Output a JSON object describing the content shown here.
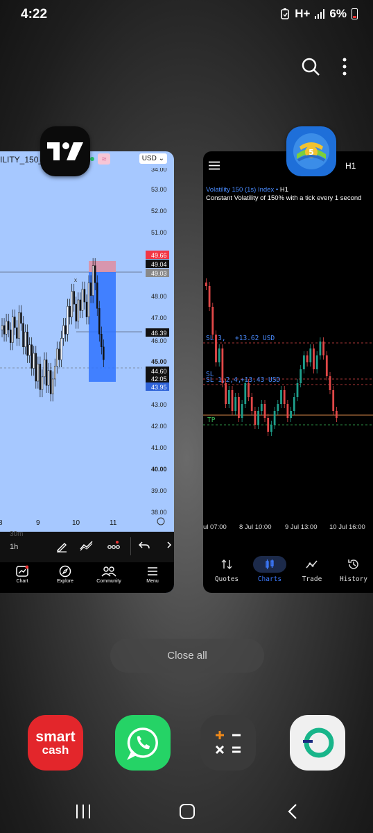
{
  "status": {
    "time": "4:22",
    "network": "H+",
    "battery": "6%"
  },
  "tradingview": {
    "symbol": "ILITY_150_",
    "currency": "USD",
    "price_labels": [
      "34.00",
      "53.00",
      "52.00",
      "51.00",
      "49.66",
      "49.04",
      "49.03",
      "48.00",
      "47.00",
      "46.39",
      "46.00",
      "45.00",
      "44.60",
      "42:05",
      "43.95",
      "43.00",
      "42.00",
      "41.00",
      "40.00",
      "39.00",
      "38.00"
    ],
    "date_labels": [
      "8",
      "9",
      "10",
      "11"
    ],
    "timeframe_faded": "30m",
    "timeframe": "1h",
    "nav": [
      "Chart",
      "Explore",
      "Community",
      "Menu"
    ]
  },
  "metatrader": {
    "timeframe": "H1",
    "info_line1_name": "Volatility 150 (1s) Index",
    "info_line1_tf": "H1",
    "info_line2": "Constant Volatility of 150% with a tick every 1 second",
    "sl_label": "SL 3,",
    "sl_profit": "+13.62 USD",
    "sl2_label": "SL",
    "sl3_label": "SL 1,2,4,",
    "sl3_profit": "+13.43 USD",
    "tp_label": "TP",
    "time_labels": [
      "ul 07:00",
      "8 Jul 10:00",
      "9 Jul 13:00",
      "10 Jul 16:00"
    ],
    "nav": [
      "Quotes",
      "Charts",
      "Trade",
      "History"
    ]
  },
  "close_all": "Close all",
  "dock": {
    "smart_cash_line1": "smart",
    "smart_cash_line2": "cash"
  },
  "colors": {
    "tv_bg": "#a6c8ff",
    "bull": "#1e9f8c",
    "bear": "#e24848",
    "accent": "#3d7bff"
  }
}
